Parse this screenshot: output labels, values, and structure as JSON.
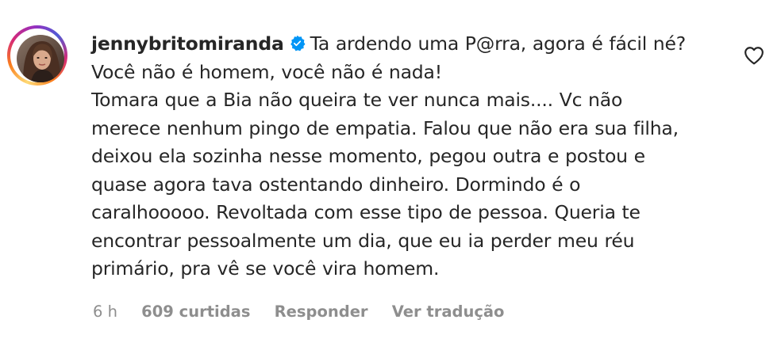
{
  "comment": {
    "username": "jennybritomiranda",
    "verified": true,
    "text_first_line": "Ta ardendo uma P@rra, agora é fácil né?",
    "text_lines": [
      "Você não é homem, você não é nada!",
      "Tomara que a Bia não queira te ver nunca mais.... Vc não",
      "merece nenhum pingo de empatia. Falou que não era sua filha,",
      "deixou ela sozinha nesse momento, pegou outra e postou e",
      "quase agora tava ostentando dinheiro. Dormindo é o",
      "caralhooooo. Revoltada com esse tipo de pessoa. Queria te",
      "encontrar pessoalmente um dia, que eu ia perder meu réu",
      "primário, pra vê se você vira homem."
    ],
    "time": "6 h",
    "likes": "609 curtidas",
    "reply_label": "Responder",
    "translate_label": "Ver tradução",
    "icons": {
      "verified": "verified-badge-icon",
      "like": "heart-icon",
      "avatar": "avatar"
    },
    "colors": {
      "verified_blue": "#0095f6",
      "meta_gray": "#8e8e8e",
      "text": "#262626"
    }
  }
}
